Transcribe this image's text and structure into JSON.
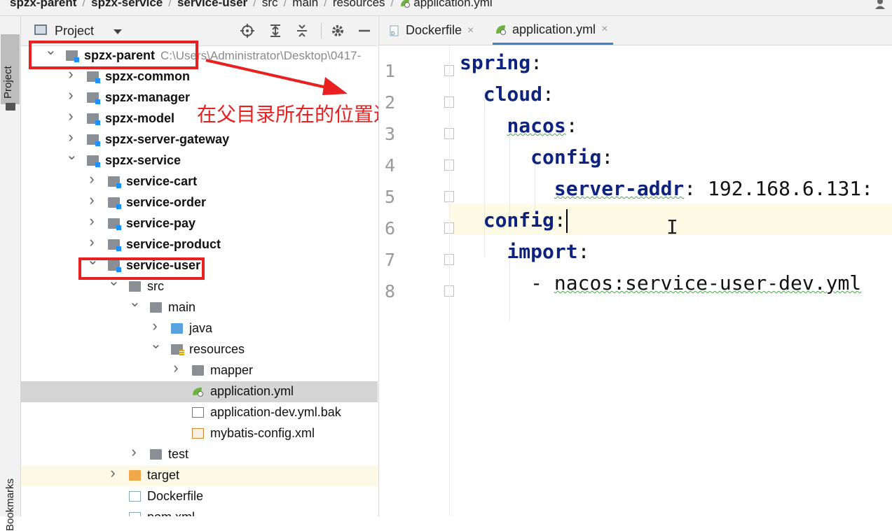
{
  "breadcrumb": [
    "spzx-parent",
    "spzx-service",
    "service-user",
    "src",
    "main",
    "resources",
    "application.yml"
  ],
  "stripe": {
    "project_label": "Project",
    "bookmarks_label": "Bookmarks"
  },
  "panel": {
    "title": "Project"
  },
  "tree": [
    {
      "label": "spzx-parent",
      "path": "C:\\Users\\Administrator\\Desktop\\0417-",
      "bold": true,
      "icon": "module-folder-icon",
      "arrow": "▾"
    },
    {
      "label": "spzx-common",
      "bold": true,
      "icon": "module-folder-icon",
      "arrow": "›"
    },
    {
      "label": "spzx-manager",
      "bold": true,
      "icon": "module-folder-icon",
      "arrow": "›"
    },
    {
      "label": "spzx-model",
      "bold": true,
      "icon": "module-folder-icon",
      "arrow": "›"
    },
    {
      "label": "spzx-server-gateway",
      "bold": true,
      "icon": "module-folder-icon",
      "arrow": "›"
    },
    {
      "label": "spzx-service",
      "bold": true,
      "icon": "module-folder-icon",
      "arrow": "▾"
    },
    {
      "label": "service-cart",
      "bold": true,
      "icon": "module-folder-icon",
      "arrow": "›"
    },
    {
      "label": "service-order",
      "bold": true,
      "icon": "module-folder-icon",
      "arrow": "›"
    },
    {
      "label": "service-pay",
      "bold": true,
      "icon": "module-folder-icon",
      "arrow": "›"
    },
    {
      "label": "service-product",
      "bold": true,
      "icon": "module-folder-icon",
      "arrow": "›"
    },
    {
      "label": "service-user",
      "bold": true,
      "icon": "module-folder-icon",
      "arrow": "▾"
    },
    {
      "label": "src",
      "bold": false,
      "icon": "folder-icon",
      "arrow": "▾"
    },
    {
      "label": "main",
      "bold": false,
      "icon": "folder-icon",
      "arrow": "▾"
    },
    {
      "label": "java",
      "bold": false,
      "icon": "source-folder-icon",
      "arrow": "›"
    },
    {
      "label": "resources",
      "bold": false,
      "icon": "resources-folder-icon",
      "arrow": "▾"
    },
    {
      "label": "mapper",
      "bold": false,
      "icon": "folder-icon",
      "arrow": "›"
    },
    {
      "label": "application.yml",
      "bold": false,
      "icon": "yml-file-icon",
      "arrow": ""
    },
    {
      "label": "application-dev.yml.bak",
      "bold": false,
      "icon": "text-file-icon",
      "arrow": ""
    },
    {
      "label": "mybatis-config.xml",
      "bold": false,
      "icon": "xml-file-icon",
      "arrow": ""
    },
    {
      "label": "test",
      "bold": false,
      "icon": "folder-icon",
      "arrow": "›"
    },
    {
      "label": "target",
      "bold": false,
      "icon": "excluded-folder-icon",
      "arrow": "›"
    },
    {
      "label": "Dockerfile",
      "bold": false,
      "icon": "docker-file-icon",
      "arrow": ""
    },
    {
      "label": "pom.xml",
      "bold": false,
      "icon": "maven-file-icon",
      "arrow": ""
    }
  ],
  "annotation": "在父目录所在的位置进行打包",
  "tabs": [
    {
      "label": "Dockerfile",
      "active": false,
      "icon": "docker-file-icon"
    },
    {
      "label": "application.yml",
      "active": true,
      "icon": "yml-file-icon"
    }
  ],
  "editor": {
    "line_numbers": [
      "1",
      "2",
      "3",
      "4",
      "5",
      "6",
      "7",
      "8"
    ],
    "lines": [
      {
        "indent": "",
        "key": "spring",
        "punc": ":",
        "value": ""
      },
      {
        "indent": "  ",
        "key": "cloud",
        "punc": ":",
        "value": ""
      },
      {
        "indent": "    ",
        "key": "nacos",
        "punc": ":",
        "value": ""
      },
      {
        "indent": "      ",
        "key": "config",
        "punc": ":",
        "value": ""
      },
      {
        "indent": "        ",
        "key": "server-addr",
        "punc": ":",
        "value": " 192.168.6.131:"
      },
      {
        "indent": "  ",
        "key": "config",
        "punc": ":",
        "value": ""
      },
      {
        "indent": "    ",
        "key": "import",
        "punc": ":",
        "value": ""
      },
      {
        "indent": "      ",
        "key": "",
        "punc": "- ",
        "value": "nacos:service-user-dev.yml"
      }
    ]
  },
  "colors": {
    "accent": "#4083c9",
    "annotation_red": "#e82020",
    "yaml_key": "#0d237e"
  }
}
